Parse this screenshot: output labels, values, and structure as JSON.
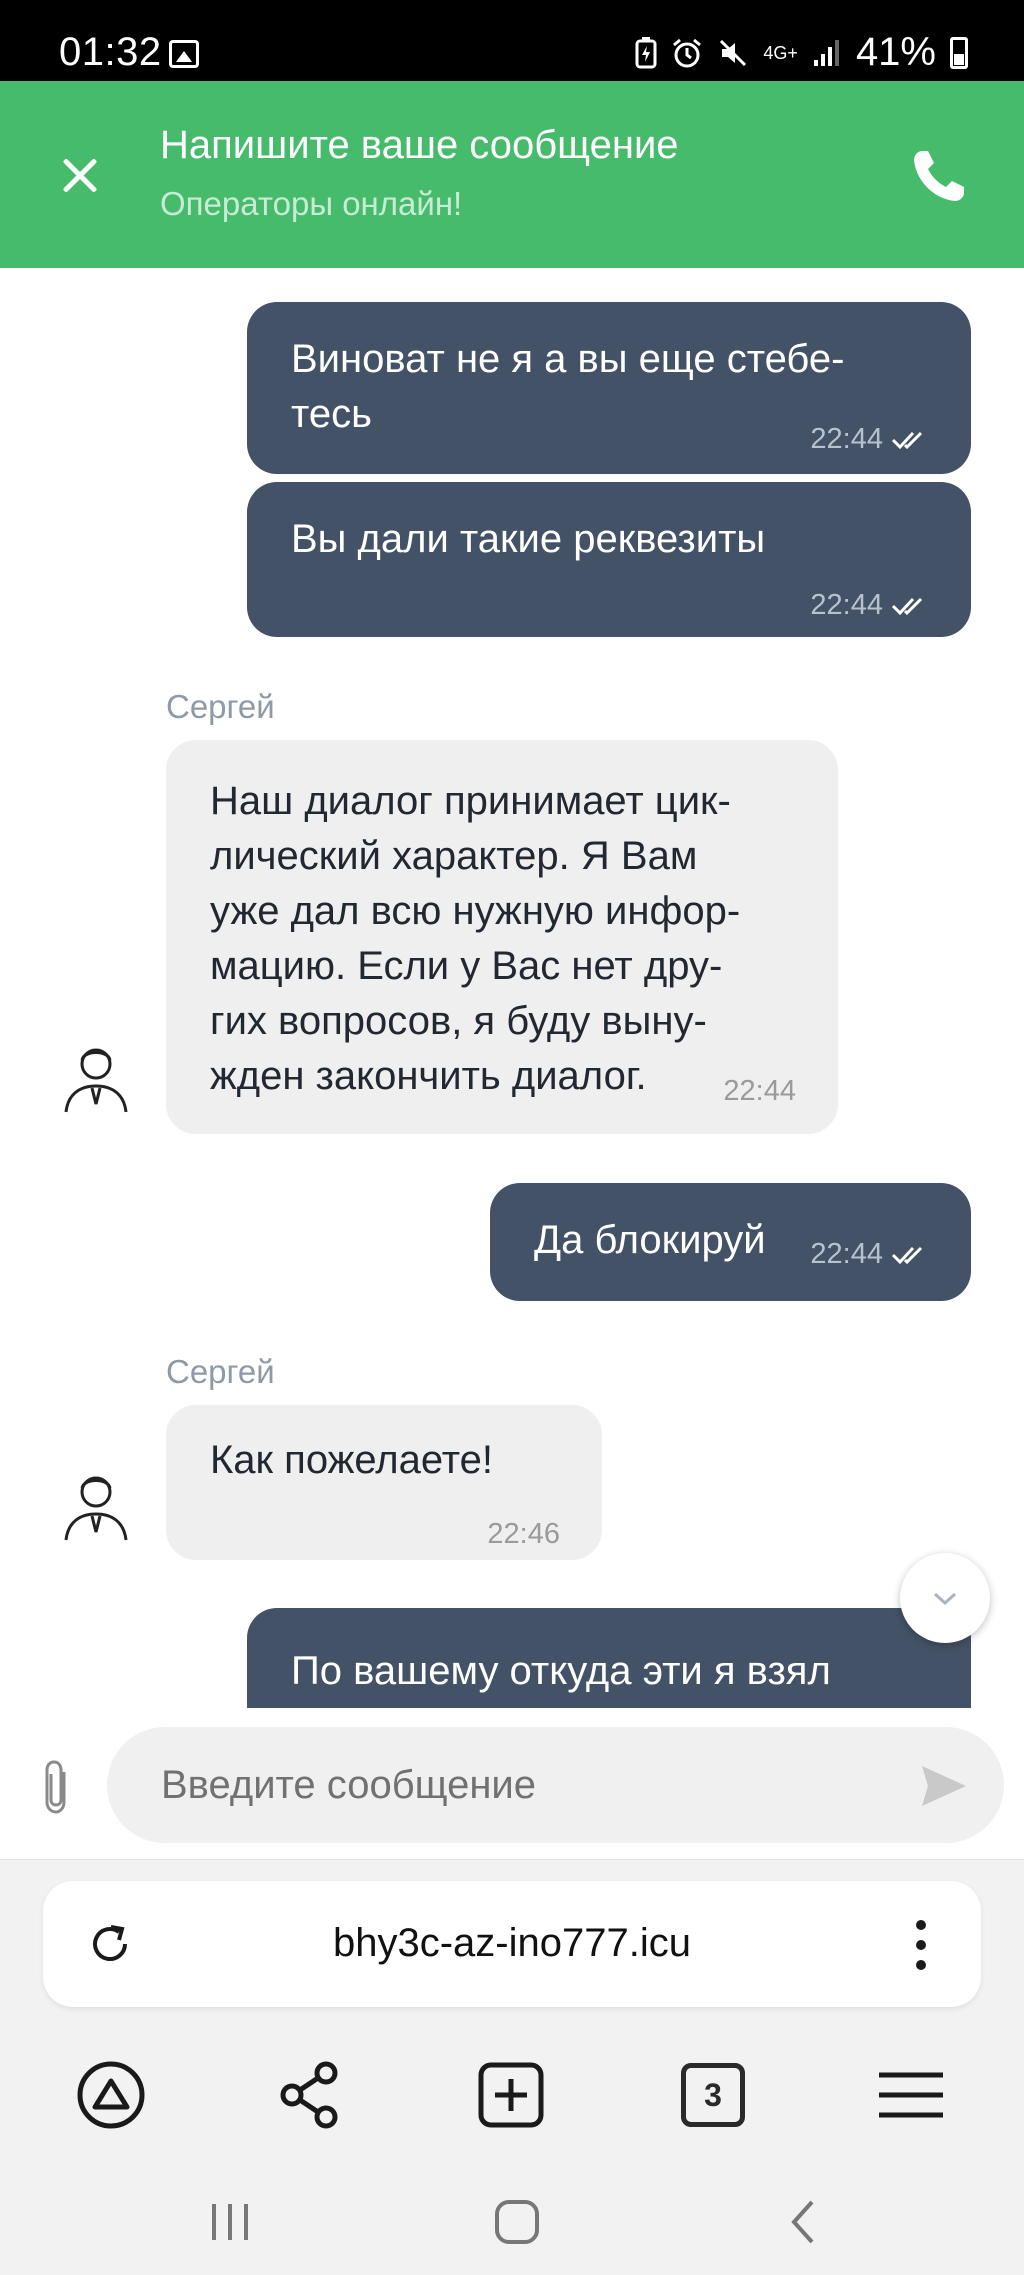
{
  "status_bar": {
    "time": "01:32",
    "network": "4G+",
    "battery": "41%",
    "icons": [
      "gallery-icon",
      "battery-saver-icon",
      "alarm-icon",
      "mute-icon",
      "network-icon",
      "signal-icon",
      "battery-icon"
    ]
  },
  "header": {
    "title": "Напишите ваше сообщение",
    "subtitle": "Операторы онлайн!",
    "accent_color": "#47bb6c"
  },
  "messages": [
    {
      "direction": "outgoing",
      "lines": [
        "Виноват не я а вы еще стебе-",
        "тесь"
      ],
      "time": "22:44",
      "read": true
    },
    {
      "direction": "outgoing",
      "lines": [
        "Вы дали такие реквезиты"
      ],
      "time": "22:44",
      "read": true
    },
    {
      "direction": "incoming",
      "sender": "Сергей",
      "lines": [
        "Наш диалог принимает цик-",
        "лический характер. Я Вам",
        "уже дал всю нужную инфор-",
        "мацию. Если у Вас нет дру-",
        "гих вопросов, я буду выну-",
        "жден закончить диалог."
      ],
      "time": "22:44"
    },
    {
      "direction": "outgoing",
      "lines": [
        "Да блокируй"
      ],
      "time": "22:44",
      "read": true
    },
    {
      "direction": "incoming",
      "sender": "Сергей",
      "lines": [
        "Как пожелаете!"
      ],
      "time": "22:46"
    },
    {
      "direction": "outgoing",
      "lines": [
        "По вашему откуда эти я взял"
      ],
      "time": "",
      "read": false
    }
  ],
  "composer": {
    "placeholder": "Введите сообщение"
  },
  "browser": {
    "url": "bhy3c-az-ino777.icu",
    "tab_count": "3",
    "toolbar_icons": [
      "alice-icon",
      "share-icon",
      "new-tab-icon",
      "tabs-icon",
      "menu-icon"
    ]
  },
  "colors": {
    "outgoing_bubble": "#435266",
    "incoming_bubble": "#efefef"
  }
}
